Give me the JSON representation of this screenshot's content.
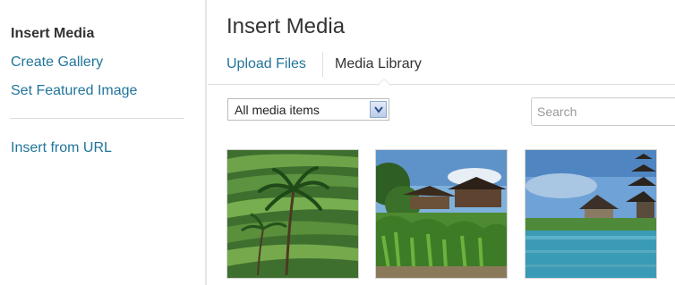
{
  "sidebar": {
    "items": [
      {
        "label": "Insert Media",
        "active": true
      },
      {
        "label": "Create Gallery",
        "active": false
      },
      {
        "label": "Set Featured Image",
        "active": false
      },
      {
        "label": "Insert from URL",
        "active": false
      }
    ]
  },
  "main": {
    "title": "Insert Media",
    "tabs": [
      {
        "label": "Upload Files",
        "active": false
      },
      {
        "label": "Media Library",
        "active": true
      }
    ],
    "filter": {
      "selected": "All media items"
    },
    "search": {
      "placeholder": "Search",
      "value": ""
    },
    "thumbnails": [
      {
        "name": "rice-terraces-photo"
      },
      {
        "name": "balinese-temple-photo"
      },
      {
        "name": "lake-temple-photo"
      }
    ]
  },
  "colors": {
    "link": "#21759b",
    "text": "#333333",
    "divider": "#dddddd"
  },
  "icons": {
    "select_arrow": "chevron-down-icon"
  }
}
